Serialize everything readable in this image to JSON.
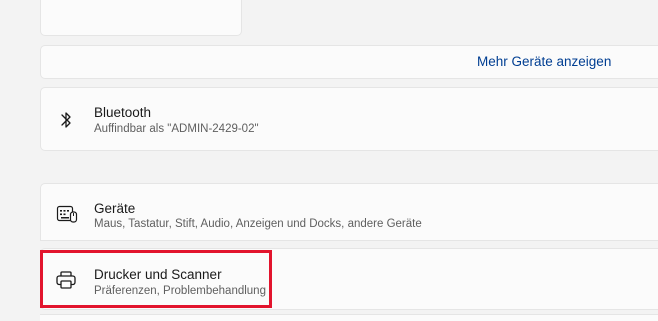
{
  "more_devices": {
    "label": "Mehr Geräte anzeigen"
  },
  "bluetooth": {
    "icon": "bluetooth-icon",
    "title": "Bluetooth",
    "subtitle": "Auffindbar als \"ADMIN-2429-02\""
  },
  "devices": {
    "icon": "devices-icon",
    "title": "Geräte",
    "subtitle": "Maus, Tastatur, Stift, Audio, Anzeigen und Docks, andere Geräte"
  },
  "printers": {
    "icon": "printer-icon",
    "title": "Drucker und Scanner",
    "subtitle": "Präferenzen, Problembehandlung"
  },
  "colors": {
    "background": "#f3f3f3",
    "card": "#fbfbfb",
    "link": "#003e92",
    "highlight": "#e2142d"
  }
}
